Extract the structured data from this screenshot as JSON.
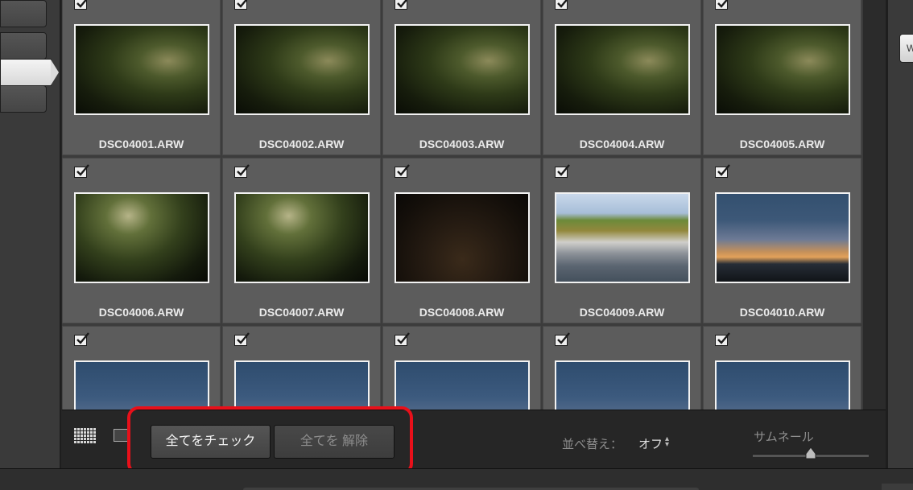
{
  "grid": {
    "rows": [
      {
        "cells": [
          {
            "filename": "DSC04001.ARW",
            "checked": true,
            "thumbnail": "forest"
          },
          {
            "filename": "DSC04002.ARW",
            "checked": true,
            "thumbnail": "forest"
          },
          {
            "filename": "DSC04003.ARW",
            "checked": true,
            "thumbnail": "forest"
          },
          {
            "filename": "DSC04004.ARW",
            "checked": true,
            "thumbnail": "forest"
          },
          {
            "filename": "DSC04005.ARW",
            "checked": true,
            "thumbnail": "forest"
          }
        ]
      },
      {
        "cells": [
          {
            "filename": "DSC04006.ARW",
            "checked": true,
            "thumbnail": "forest2"
          },
          {
            "filename": "DSC04007.ARW",
            "checked": true,
            "thumbnail": "forest2"
          },
          {
            "filename": "DSC04008.ARW",
            "checked": true,
            "thumbnail": "dark"
          },
          {
            "filename": "DSC04009.ARW",
            "checked": true,
            "thumbnail": "lot"
          },
          {
            "filename": "DSC04010.ARW",
            "checked": true,
            "thumbnail": "sunset"
          }
        ]
      },
      {
        "cells": [
          {
            "filename": "",
            "checked": true,
            "thumbnail": "dusk"
          },
          {
            "filename": "",
            "checked": true,
            "thumbnail": "dusk"
          },
          {
            "filename": "",
            "checked": true,
            "thumbnail": "dusk"
          },
          {
            "filename": "",
            "checked": true,
            "thumbnail": "dusk"
          },
          {
            "filename": "",
            "checked": true,
            "thumbnail": "dusk"
          }
        ]
      }
    ]
  },
  "toolbar": {
    "check_all_label": "全てをチェック",
    "uncheck_all_label": "全てを 解除",
    "sort_label": "並べ替え：",
    "sort_value": "オフ",
    "thumbnail_label": "サムネール",
    "thumbnail_size": 0.5
  },
  "right_panel": {
    "button_label": "W"
  },
  "colors": {
    "highlight": "#e8101a",
    "panel": "#5c5c5c",
    "background": "#262626"
  }
}
